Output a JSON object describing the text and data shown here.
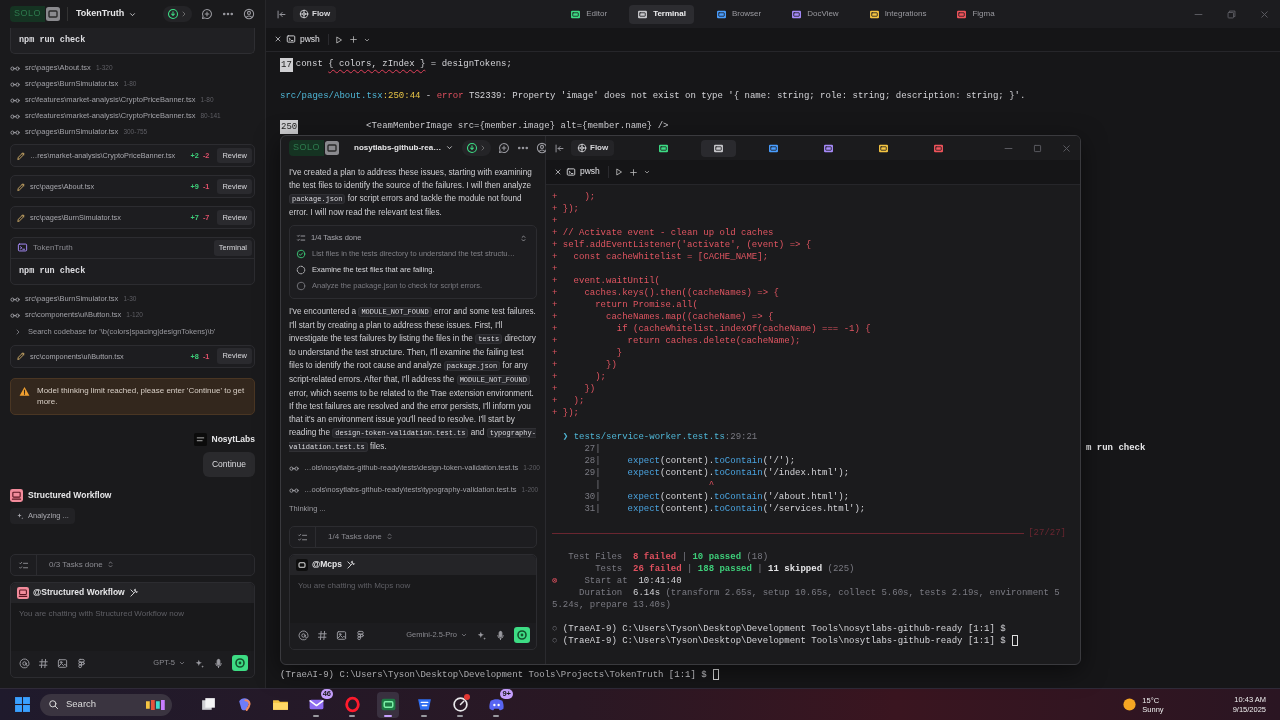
{
  "left_panel": {
    "header": {
      "logo": "SOLO",
      "project": "TokenTruth"
    },
    "feed": [
      {
        "kind": "command",
        "command": "npm run check"
      },
      {
        "kind": "read",
        "path": "src\\pages\\About.tsx",
        "range": "1-320"
      },
      {
        "kind": "read",
        "path": "src\\pages\\BurnSimulator.tsx",
        "range": "1-80"
      },
      {
        "kind": "read",
        "path": "src\\features\\market-analysis\\CryptoPriceBanner.tsx",
        "range": "1-80"
      },
      {
        "kind": "read",
        "path": "src\\features\\market-analysis\\CryptoPriceBanner.tsx",
        "range": "80-141"
      },
      {
        "kind": "read",
        "path": "src\\pages\\BurnSimulator.tsx",
        "range": "300-755"
      },
      {
        "kind": "edit",
        "path": "…res\\market-analysis\\CryptoPriceBanner.tsx",
        "added": "+2",
        "removed": "-2",
        "action": "Review"
      },
      {
        "kind": "edit",
        "path": "src\\pages\\About.tsx",
        "added": "+9",
        "removed": "-1",
        "action": "Review"
      },
      {
        "kind": "edit",
        "path": "src\\pages\\BurnSimulator.tsx",
        "added": "+7",
        "removed": "-7",
        "action": "Review"
      },
      {
        "kind": "terminal",
        "project": "TokenTruth",
        "action": "Terminal",
        "command": "npm run check"
      },
      {
        "kind": "read",
        "path": "src\\pages\\BurnSimulator.tsx",
        "range": "1-30"
      },
      {
        "kind": "read",
        "path": "src\\components\\ui\\Button.tsx",
        "range": "1-120"
      },
      {
        "kind": "search",
        "text": "Search codebase for '\\b(colors|spacing|designTokens)\\b'"
      },
      {
        "kind": "edit",
        "path": "src\\components\\ui\\Button.tsx",
        "added": "+8",
        "removed": "-1",
        "action": "Review"
      },
      {
        "kind": "warning",
        "text": "Model thinking limit reached, please enter 'Continue' to get more."
      },
      {
        "kind": "user",
        "name": "NosytLabs",
        "message": "Continue"
      },
      {
        "kind": "agent",
        "name": "Structured Workflow",
        "status": "Analyzing ..."
      }
    ],
    "tasks": "0/3 Tasks done",
    "composer": {
      "agent": "@Structured Workflow",
      "placeholder": "You are chatting with Structured Workflow now",
      "model": "GPT-5"
    }
  },
  "main": {
    "flow": "Flow",
    "tabs": [
      {
        "label": "Editor",
        "selected": false,
        "color": "#3ddc84"
      },
      {
        "label": "Terminal",
        "selected": true,
        "color": "#c8c8cc"
      },
      {
        "label": "Browser",
        "selected": false,
        "color": "#4a9eff"
      },
      {
        "label": "DocView",
        "selected": false,
        "color": "#a78bfa"
      },
      {
        "label": "Integrations",
        "selected": false,
        "color": "#f5c542"
      },
      {
        "label": "Figma",
        "selected": false,
        "color": "#f2545b"
      }
    ],
    "terminal": {
      "tab": "pwsh",
      "lines": [
        {
          "p": [
            {
              "kind": "lineno",
              "text": "17"
            },
            {
              "kind": "text",
              "text": "const "
            },
            {
              "kind": "squiggle",
              "text": "{ colors, zIndex }"
            },
            {
              "kind": "text",
              "text": " = designTokens;"
            }
          ]
        },
        {
          "gap": true,
          "p": [
            {
              "kind": "path",
              "text": "src/pages/About.tsx"
            },
            {
              "kind": "yellow",
              "text": ":250:44"
            },
            {
              "kind": "text",
              "text": " - "
            },
            {
              "kind": "red",
              "text": "error"
            },
            {
              "kind": "text",
              "text": " TS2339: Property 'image' does not exist on type '{ name: string; role: string; description: string; }'."
            }
          ]
        },
        {
          "gap": true,
          "p": [
            {
              "kind": "lineno",
              "text": "250"
            },
            {
              "kind": "text",
              "text": "            <TeamMemberImage src={member.image} alt={member.name} />"
            }
          ]
        }
      ],
      "fragment": "m run check",
      "prompt": "(TraeAI-9) C:\\Users\\Tyson\\Desktop\\Development Tools\\Projects\\TokenTruth [1:1] $",
      "cursor": true
    }
  },
  "overlay": {
    "header": {
      "logo": "SOLO",
      "project": "nosytlabs-github-rea…"
    },
    "chat": [
      {
        "kind": "paragraph",
        "parts": [
          {
            "text": "I've created a plan to address these issues, starting with examining the test files to identify the source of the failures. I will then analyze ",
            "code": false
          },
          {
            "text": "package.json",
            "code": true
          },
          {
            "text": " for script errors and tackle the module not found error. I will now read the relevant test files.",
            "code": false
          }
        ]
      },
      {
        "kind": "tasks",
        "summary": "1/4 Tasks done",
        "items": [
          {
            "text": "List files in the tests directory to understand the test structu…",
            "done": true,
            "running": false
          },
          {
            "text": "Examine the test files that are failing.",
            "done": false,
            "running": true
          },
          {
            "text": "Analyze the package.json to check for script errors.",
            "done": false,
            "running": false
          }
        ]
      },
      {
        "kind": "paragraph",
        "parts": [
          {
            "text": "I've encountered a ",
            "code": false
          },
          {
            "text": "MODULE_NOT_FOUND",
            "code": true
          },
          {
            "text": " error and some test failures. I'll start by creating a plan to address these issues. First, I'll investigate the test failures by listing the files in the ",
            "code": false
          },
          {
            "text": "tests",
            "code": true
          },
          {
            "text": " directory to understand the test structure. Then, I'll examine the failing test files to identify the root cause and analyze ",
            "code": false
          },
          {
            "text": "package.json",
            "code": true
          },
          {
            "text": " for any script-related errors. After that, I'll address the ",
            "code": false
          },
          {
            "text": "MODULE_NOT_FOUND",
            "code": true
          },
          {
            "text": " error, which seems to be related to the Trae extension environment. If the test failures are resolved and the error persists, I'll inform you that it's an environment issue you'll need to resolve. I'll start by reading the ",
            "code": false
          },
          {
            "text": "design-token-validation.test.ts",
            "code": true
          },
          {
            "text": " and ",
            "code": false
          },
          {
            "text": "typography-validation.test.ts",
            "code": true
          },
          {
            "text": " files.",
            "code": false
          }
        ]
      },
      {
        "kind": "read",
        "path": "…ols\\nosytlabs-github-ready\\tests\\design-token-validation.test.ts",
        "range": "1-200"
      },
      {
        "kind": "read",
        "path": "…ools\\nosytlabs-github-ready\\tests\\typography-validation.test.ts",
        "range": "1-200"
      },
      {
        "kind": "thinking",
        "text": "Thinking ..."
      }
    ],
    "tasks": "1/4 Tasks done",
    "composer": {
      "agent": "@Mcps",
      "placeholder": "You are chatting with Mcps now",
      "model": "Gemini-2.5-Pro"
    },
    "flow": "Flow",
    "tabs": [
      {
        "selected": false,
        "color": "#3ddc84"
      },
      {
        "selected": true,
        "color": "#c8c8cc"
      },
      {
        "selected": false,
        "color": "#4a9eff"
      },
      {
        "selected": false,
        "color": "#a78bfa"
      },
      {
        "selected": false,
        "color": "#f5c542"
      },
      {
        "selected": false,
        "color": "#f2545b"
      }
    ],
    "terminal": {
      "tab": "pwsh",
      "cursor": true,
      "lines": [
        {
          "p": [
            {
              "kind": "diff",
              "text": "+     );"
            }
          ]
        },
        {
          "p": [
            {
              "kind": "diff",
              "text": "+ });"
            }
          ]
        },
        {
          "p": [
            {
              "kind": "diff",
              "text": "+"
            }
          ]
        },
        {
          "p": [
            {
              "kind": "diff",
              "text": "+ // Activate event - clean up old caches"
            }
          ]
        },
        {
          "p": [
            {
              "kind": "diff",
              "text": "+ self.addEventListener('activate', (event) => {"
            }
          ]
        },
        {
          "p": [
            {
              "kind": "diff",
              "text": "+   const cacheWhitelist = [CACHE_NAME];"
            }
          ]
        },
        {
          "p": [
            {
              "kind": "diff",
              "text": "+"
            }
          ]
        },
        {
          "p": [
            {
              "kind": "diff",
              "text": "+   event.waitUntil("
            }
          ]
        },
        {
          "p": [
            {
              "kind": "diff",
              "text": "+     caches.keys().then((cacheNames) => {"
            }
          ]
        },
        {
          "p": [
            {
              "kind": "diff",
              "text": "+       return Promise.all("
            }
          ]
        },
        {
          "p": [
            {
              "kind": "diff",
              "text": "+         cacheNames.map((cacheName) => {"
            }
          ]
        },
        {
          "p": [
            {
              "kind": "diff",
              "text": "+           if (cacheWhitelist.indexOf(cacheName) === -1) {"
            }
          ]
        },
        {
          "p": [
            {
              "kind": "diff",
              "text": "+             return caches.delete(cacheName);"
            }
          ]
        },
        {
          "p": [
            {
              "kind": "diff",
              "text": "+           }"
            }
          ]
        },
        {
          "p": [
            {
              "kind": "diff",
              "text": "+         })"
            }
          ]
        },
        {
          "p": [
            {
              "kind": "diff",
              "text": "+       );"
            }
          ]
        },
        {
          "p": [
            {
              "kind": "diff",
              "text": "+     })"
            }
          ]
        },
        {
          "p": [
            {
              "kind": "diff",
              "text": "+   );"
            }
          ]
        },
        {
          "p": [
            {
              "kind": "diff",
              "text": "+ });"
            }
          ]
        },
        {
          "gap": true,
          "p": [
            {
              "kind": "path",
              "text": "  ❯ tests/service-worker.test.ts"
            },
            {
              "kind": "dim",
              "text": ":29:21"
            }
          ]
        },
        {
          "p": [
            {
              "kind": "dim",
              "text": "      27|"
            }
          ]
        },
        {
          "p": [
            {
              "kind": "dim",
              "text": "      28|"
            },
            {
              "kind": "fn",
              "text": "     expect"
            },
            {
              "kind": "text",
              "text": "(content)."
            },
            {
              "kind": "fn",
              "text": "toContain"
            },
            {
              "kind": "text",
              "text": "('/');"
            }
          ]
        },
        {
          "p": [
            {
              "kind": "dim",
              "text": "      29|"
            },
            {
              "kind": "fn",
              "text": "     expect"
            },
            {
              "kind": "text",
              "text": "(content)."
            },
            {
              "kind": "fn",
              "text": "toContain"
            },
            {
              "kind": "text",
              "text": "('/index.html');"
            }
          ]
        },
        {
          "p": [
            {
              "kind": "dim",
              "text": "        |"
            },
            {
              "kind": "red",
              "text": "                    ^"
            }
          ]
        },
        {
          "p": [
            {
              "kind": "dim",
              "text": "      30|"
            },
            {
              "kind": "fn",
              "text": "     expect"
            },
            {
              "kind": "text",
              "text": "(content)."
            },
            {
              "kind": "fn",
              "text": "toContain"
            },
            {
              "kind": "text",
              "text": "('/about.html');"
            }
          ]
        },
        {
          "p": [
            {
              "kind": "dim",
              "text": "      31|"
            },
            {
              "kind": "fn",
              "text": "     expect"
            },
            {
              "kind": "text",
              "text": "(content)."
            },
            {
              "kind": "fn",
              "text": "toContain"
            },
            {
              "kind": "text",
              "text": "('/services.html');"
            }
          ]
        },
        {
          "gap": true,
          "p": [
            {
              "kind": "rule",
              "text": "[27/27]"
            }
          ]
        },
        {
          "gap": true,
          "p": [
            {
              "kind": "dim",
              "text": "   Test Files  "
            },
            {
              "kind": "fail",
              "text": "8 failed"
            },
            {
              "kind": "dim",
              "text": " | "
            },
            {
              "kind": "pass",
              "text": "10 passed"
            },
            {
              "kind": "dim",
              "text": " (18)"
            }
          ]
        },
        {
          "p": [
            {
              "kind": "dim",
              "text": "        Tests  "
            },
            {
              "kind": "fail",
              "text": "26 failed"
            },
            {
              "kind": "dim",
              "text": " | "
            },
            {
              "kind": "pass",
              "text": "188 passed"
            },
            {
              "kind": "dim",
              "text": " | "
            },
            {
              "kind": "bold",
              "text": "11 skipped"
            },
            {
              "kind": "dim",
              "text": " (225)"
            }
          ]
        },
        {
          "p": [
            {
              "kind": "red",
              "text": "⊗"
            },
            {
              "kind": "dim",
              "text": "     Start at  "
            },
            {
              "kind": "text",
              "text": "10:41:40"
            }
          ]
        },
        {
          "p": [
            {
              "kind": "dim",
              "text": "     Duration  "
            },
            {
              "kind": "text",
              "text": "6.14s "
            },
            {
              "kind": "dim",
              "text": "(transform 2.65s, setup 10.65s, collect 5.60s, tests 2.19s, environment 55.24s, prepare 13.40s)"
            }
          ]
        },
        {
          "gap": true,
          "p": [
            {
              "kind": "dim",
              "text": "○ "
            },
            {
              "kind": "text",
              "text": "(TraeAI-9) C:\\Users\\Tyson\\Desktop\\Development Tools\\nosytlabs-github-ready [1:1] $"
            }
          ]
        },
        {
          "p": [
            {
              "kind": "dim",
              "text": "○ "
            },
            {
              "kind": "text",
              "text": "(TraeAI-9) C:\\Users\\Tyson\\Desktop\\Development Tools\\nosytlabs-github-ready [1:1] $ "
            }
          ]
        }
      ]
    }
  },
  "taskbar": {
    "search": "Search",
    "apps": [
      {
        "kind": "taskview",
        "selected": false,
        "running": false,
        "alert": false
      },
      {
        "kind": "copilot",
        "selected": false,
        "running": false,
        "alert": false
      },
      {
        "kind": "folder",
        "selected": false,
        "running": false,
        "alert": false
      },
      {
        "kind": "mail",
        "badge": "46",
        "selected": false,
        "running": true,
        "alert": false
      },
      {
        "kind": "opera",
        "selected": false,
        "running": true,
        "alert": false
      },
      {
        "kind": "terminal",
        "selected": true,
        "running": true,
        "alert": false
      },
      {
        "kind": "shield",
        "selected": false,
        "running": true,
        "alert": false
      },
      {
        "kind": "dial",
        "selected": false,
        "running": true,
        "alert": true
      },
      {
        "kind": "discord",
        "badge": "9+",
        "selected": false,
        "running": true,
        "alert": false
      }
    ],
    "weather": {
      "temp": "15°C",
      "condition": "Sunny"
    },
    "clock": {
      "time": "10:43 AM",
      "date": "9/15/2025"
    }
  }
}
